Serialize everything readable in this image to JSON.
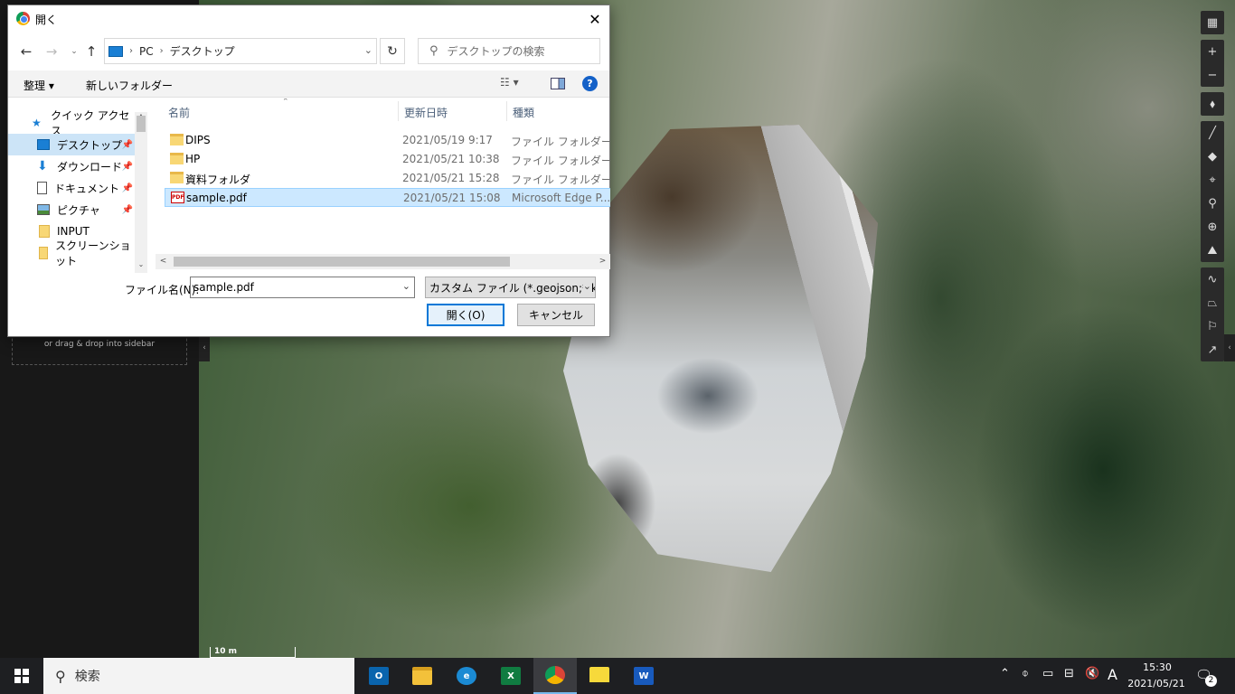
{
  "dialog": {
    "title": "開く",
    "breadcrumb": [
      "PC",
      "デスクトップ"
    ],
    "search_placeholder": "デスクトップの検索",
    "toolbar": {
      "organize": "整理 ▾",
      "new_folder": "新しいフォルダー",
      "view": "☷ ▾",
      "help": "?"
    },
    "nav_items": [
      {
        "label": "クイック アクセス",
        "icon": "star-icon",
        "pinned": false
      },
      {
        "label": "デスクトップ",
        "icon": "desktop-icon",
        "pinned": true,
        "selected": true
      },
      {
        "label": "ダウンロード",
        "icon": "download-icon",
        "pinned": true
      },
      {
        "label": "ドキュメント",
        "icon": "document-icon",
        "pinned": true
      },
      {
        "label": "ピクチャ",
        "icon": "pictures-icon",
        "pinned": true
      },
      {
        "label": "INPUT",
        "icon": "folder-icon",
        "pinned": false
      },
      {
        "label": "スクリーンショット",
        "icon": "folder-icon",
        "pinned": false
      }
    ],
    "columns": {
      "name": "名前",
      "date": "更新日時",
      "type": "種類"
    },
    "files": [
      {
        "name": "DIPS",
        "date": "2021/05/19 9:17",
        "type": "ファイル フォルダー",
        "icon": "folder-icon"
      },
      {
        "name": "HP",
        "date": "2021/05/21 10:38",
        "type": "ファイル フォルダー",
        "icon": "folder-icon"
      },
      {
        "name": "資料フォルダ",
        "date": "2021/05/21 15:28",
        "type": "ファイル フォルダー",
        "icon": "folder-icon"
      },
      {
        "name": "sample.pdf",
        "date": "2021/05/21 15:08",
        "type": "Microsoft Edge P...",
        "icon": "pdf-icon",
        "selected": true
      }
    ],
    "filename_label": "ファイル名(N):",
    "filename_value": "sample.pdf",
    "filetype_value": "カスタム ファイル (*.geojson;*.kml;",
    "open_label": "開く(O)",
    "cancel_label": "キャンセル"
  },
  "map_app": {
    "drop_hint": "or drag & drop into sidebar",
    "scale_label": "10 m"
  },
  "taskbar": {
    "search_text": "検索",
    "apps": [
      {
        "name": "outlook",
        "glyph": "O",
        "color": "#0a64ad"
      },
      {
        "name": "file-explorer",
        "glyph": "",
        "color": "#f3c13a"
      },
      {
        "name": "edge",
        "glyph": "e",
        "color": "#1b8ad3"
      },
      {
        "name": "excel",
        "glyph": "X",
        "color": "#107c41"
      },
      {
        "name": "chrome",
        "glyph": "",
        "color": "#db4437",
        "active": true
      },
      {
        "name": "sticky-notes",
        "glyph": "",
        "color": "#f7d93b"
      },
      {
        "name": "word",
        "glyph": "W",
        "color": "#185abd"
      }
    ],
    "ime_indicator": "A",
    "time": "15:30",
    "date": "2021/05/21",
    "notification_count": "2"
  }
}
